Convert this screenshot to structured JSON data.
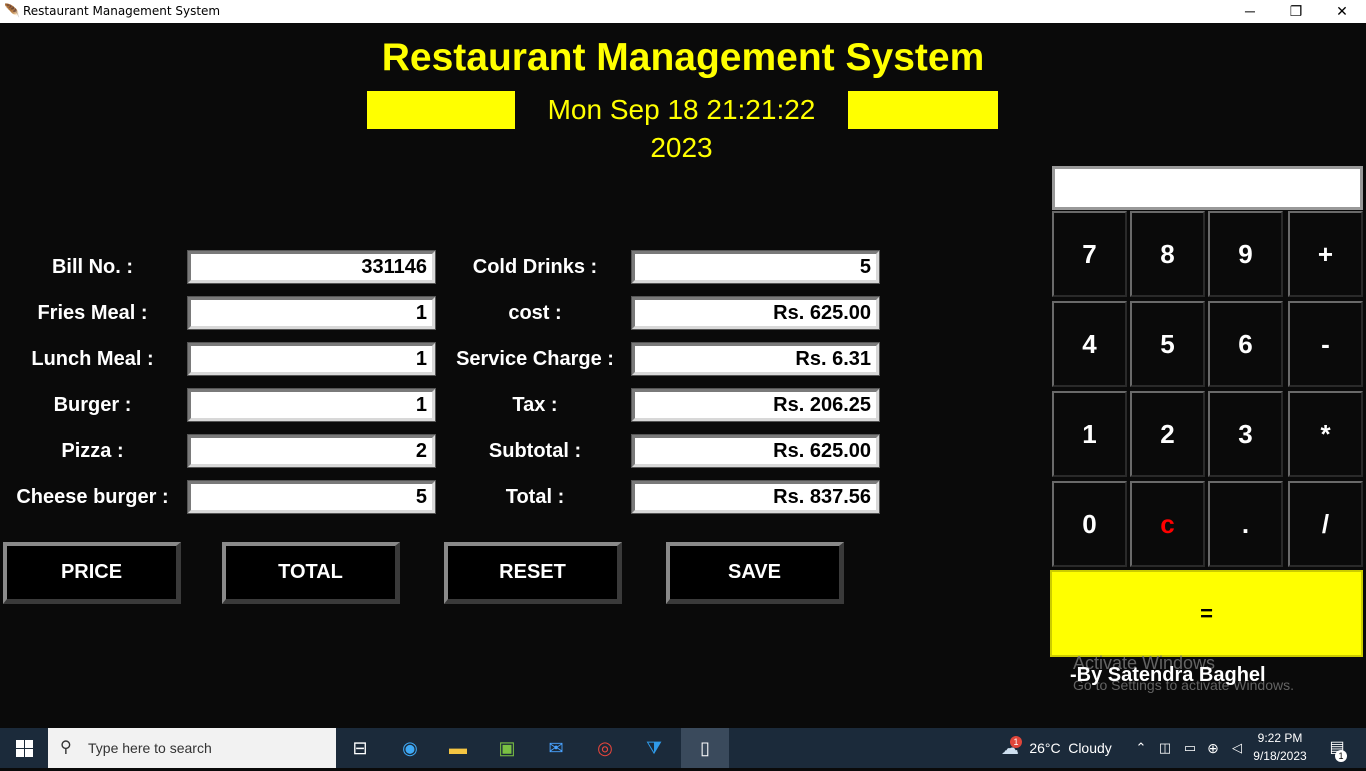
{
  "window": {
    "title": "Restaurant Management System",
    "minimize": "─",
    "restore": "❐",
    "close": "✕"
  },
  "header": {
    "title": "Restaurant Management System",
    "datetime": "Mon Sep 18 21:21:22 2023"
  },
  "left_fields": [
    {
      "label": "Bill No. :",
      "value": "331146"
    },
    {
      "label": "Fries Meal :",
      "value": "1"
    },
    {
      "label": "Lunch Meal :",
      "value": "1"
    },
    {
      "label": "Burger :",
      "value": "1"
    },
    {
      "label": "Pizza :",
      "value": "2"
    },
    {
      "label": "Cheese burger :",
      "value": "5"
    }
  ],
  "right_fields": [
    {
      "label": "Cold Drinks :",
      "value": "5"
    },
    {
      "label": "cost :",
      "value": "Rs. 625.00"
    },
    {
      "label": "Service Charge :",
      "value": "Rs. 6.31"
    },
    {
      "label": "Tax :",
      "value": "Rs. 206.25"
    },
    {
      "label": "Subtotal :",
      "value": "Rs. 625.00"
    },
    {
      "label": "Total :",
      "value": "Rs. 837.56"
    }
  ],
  "actions": {
    "price": "PRICE",
    "total": "TOTAL",
    "reset": "RESET",
    "save": "SAVE"
  },
  "calculator": {
    "display": "",
    "keys": [
      "7",
      "8",
      "9",
      "+",
      "4",
      "5",
      "6",
      "-",
      "1",
      "2",
      "3",
      "*",
      "0",
      "c",
      ".",
      "/"
    ],
    "equals": "=",
    "clear_color": "#ff0000"
  },
  "author": "-By Satendra Baghel",
  "watermark": {
    "line1": "Activate Windows",
    "line2": "Go to Settings to activate Windows."
  },
  "taskbar": {
    "search_placeholder": "Type here to search",
    "weather_temp": "26°C",
    "weather_text": "Cloudy",
    "weather_badge": "1",
    "time": "9:22 PM",
    "date": "9/18/2023",
    "notification_count": "1"
  },
  "colors": {
    "accent": "#ffff00",
    "background": "#0a0a0a",
    "taskbar": "#1b2a3a"
  }
}
